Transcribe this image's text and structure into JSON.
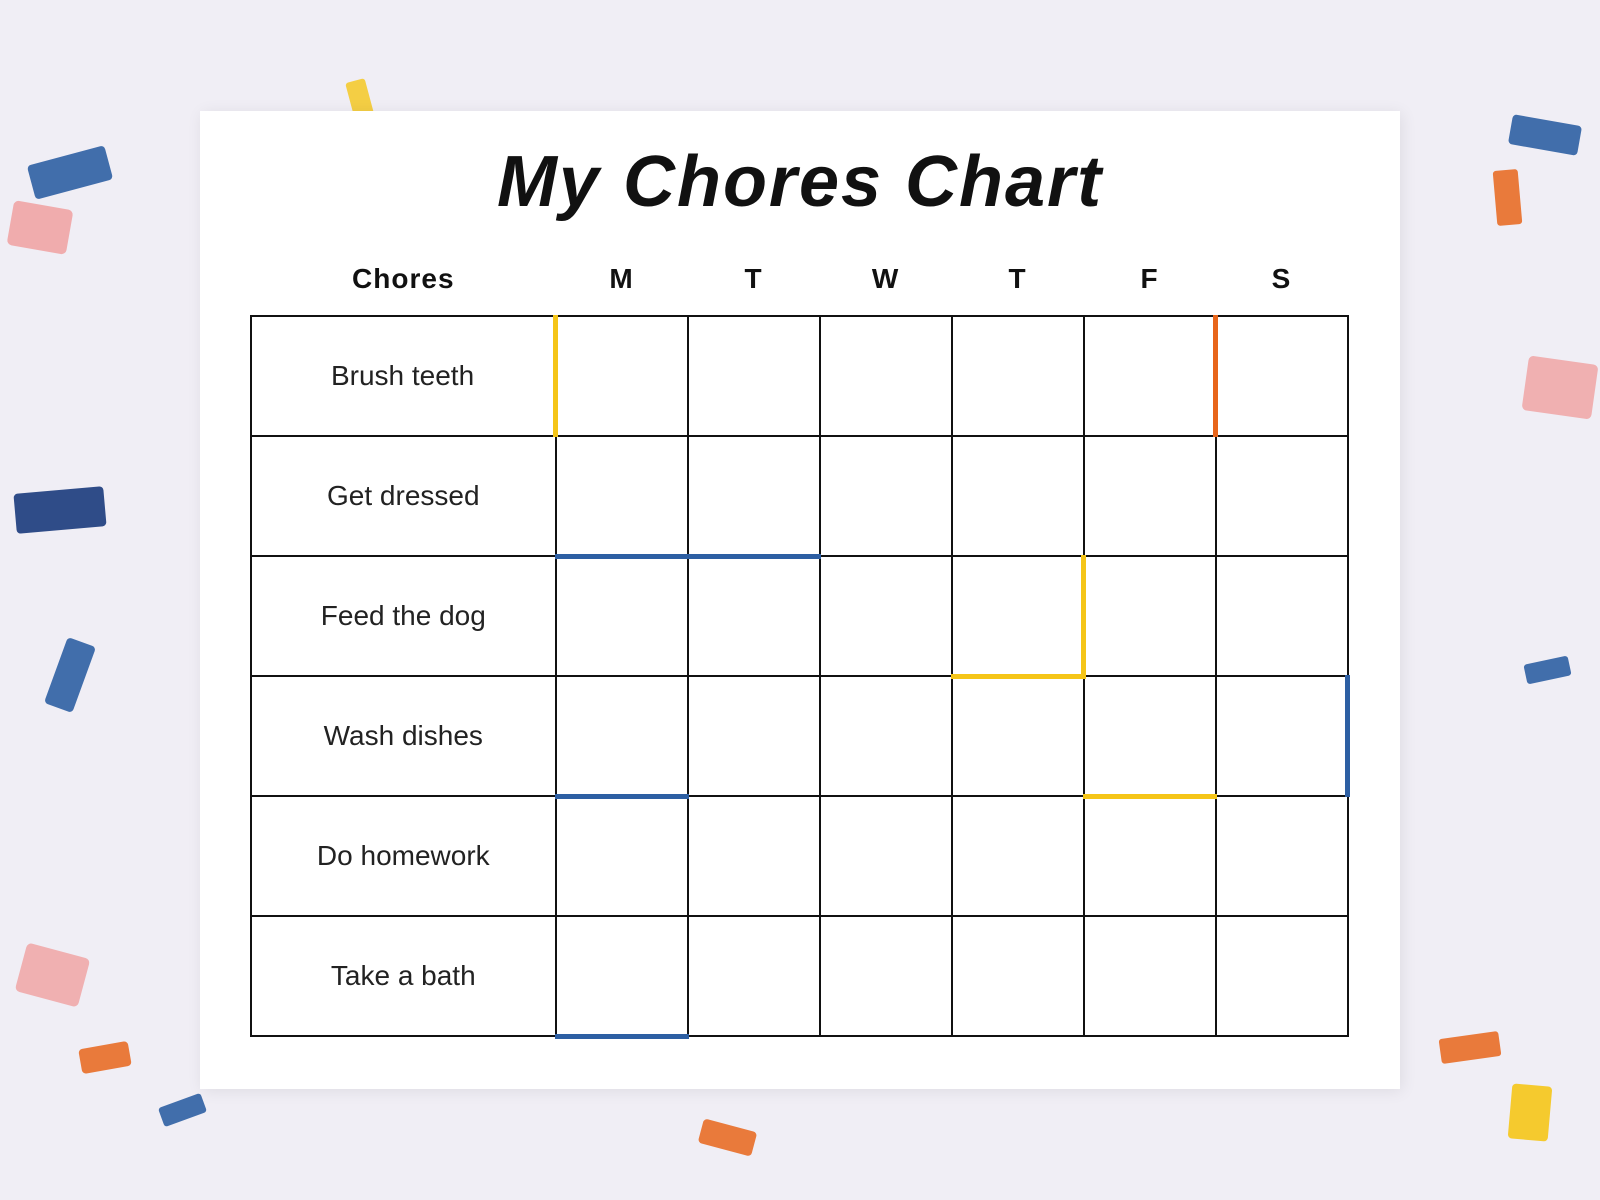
{
  "title": "My Chores Chart",
  "headers": {
    "chores": "Chores",
    "days": [
      "M",
      "T",
      "W",
      "T",
      "F",
      "S"
    ]
  },
  "chores": [
    "Brush teeth",
    "Get dressed",
    "Feed the dog",
    "Wash dishes",
    "Do homework",
    "Take a bath"
  ],
  "decorations": {
    "colors": {
      "blue": "#2d5fa3",
      "orange": "#e8651a",
      "yellow": "#f5c518",
      "pink": "#f0a0a0",
      "darkblue": "#1a3a7c"
    }
  }
}
